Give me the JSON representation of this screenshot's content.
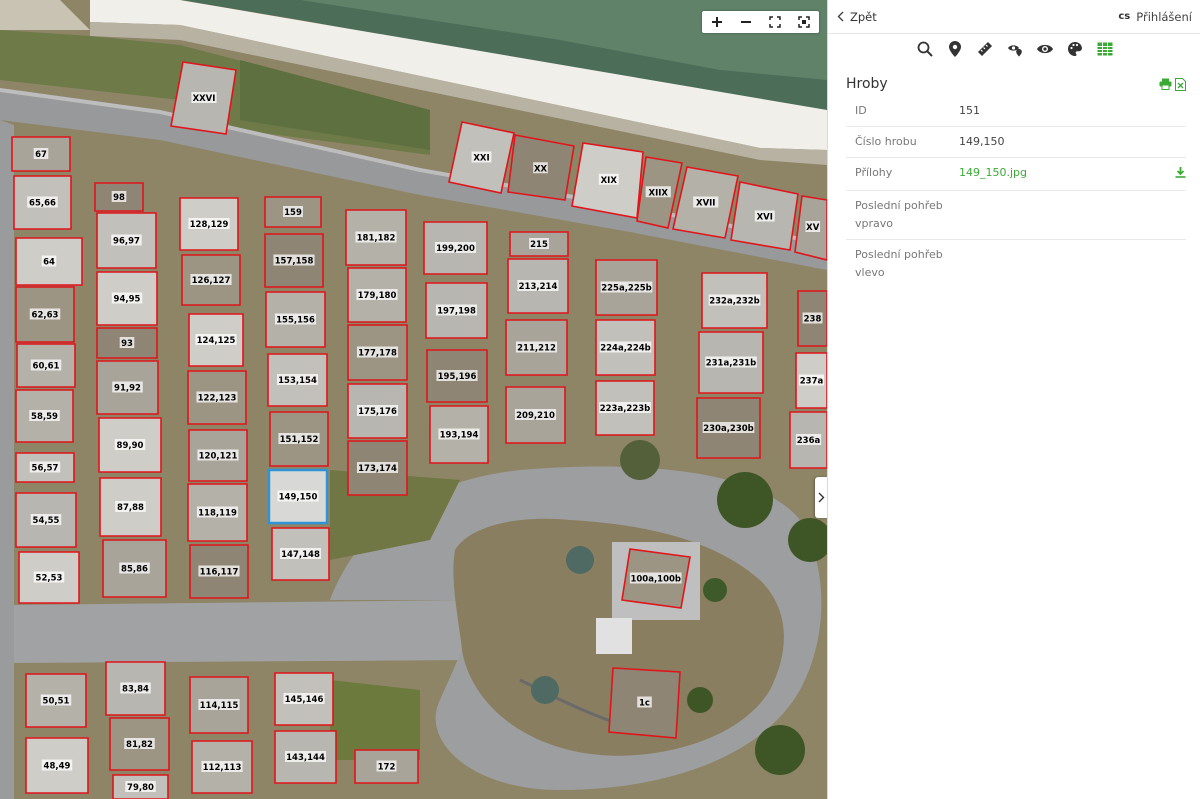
{
  "panel": {
    "back_label": "Zpět",
    "lang": "cs",
    "login_label": "Přihlášení",
    "toolbar": [
      {
        "name": "search-icon"
      },
      {
        "name": "location-pin-icon"
      },
      {
        "name": "measure-icon"
      },
      {
        "name": "location-eye-icon"
      },
      {
        "name": "eye-icon"
      },
      {
        "name": "palette-icon"
      },
      {
        "name": "table-icon"
      }
    ],
    "section_title": "Hroby",
    "rows": [
      {
        "key": "ID",
        "value": "151"
      },
      {
        "key": "Číslo hrobu",
        "value": "149,150"
      },
      {
        "key": "Přílohy",
        "value": "149_150.jpg"
      },
      {
        "key": "Poslední pohřeb vpravo",
        "value": ""
      },
      {
        "key": "Poslední pohřeb vlevo",
        "value": ""
      }
    ]
  },
  "colors": {
    "accent_green": "#3aaa35",
    "plot_outline": "#e0141b",
    "selected_outline": "#2f93d6"
  },
  "map": {
    "plots": [
      {
        "label": "XXVI"
      },
      {
        "label": "67"
      },
      {
        "label": "XXI"
      },
      {
        "label": "XX"
      },
      {
        "label": "XIX"
      },
      {
        "label": "XIIX"
      },
      {
        "label": "XVII"
      },
      {
        "label": "XVI"
      },
      {
        "label": "XV"
      },
      {
        "label": "65,66"
      },
      {
        "label": "98"
      },
      {
        "label": "128,129"
      },
      {
        "label": "159"
      },
      {
        "label": "181,182"
      },
      {
        "label": "199,200"
      },
      {
        "label": "215"
      },
      {
        "label": "96,97"
      },
      {
        "label": "157,158"
      },
      {
        "label": "64"
      },
      {
        "label": "126,127"
      },
      {
        "label": "179,180"
      },
      {
        "label": "213,214"
      },
      {
        "label": "225a,225b"
      },
      {
        "label": "232a,232b"
      },
      {
        "label": "238"
      },
      {
        "label": "94,95"
      },
      {
        "label": "62,63"
      },
      {
        "label": "155,156"
      },
      {
        "label": "197,198"
      },
      {
        "label": "211,212"
      },
      {
        "label": "224a,224b"
      },
      {
        "label": "93"
      },
      {
        "label": "124,125"
      },
      {
        "label": "177,178"
      },
      {
        "label": "60,61"
      },
      {
        "label": "231a,231b"
      },
      {
        "label": "91,92"
      },
      {
        "label": "153,154"
      },
      {
        "label": "195,196"
      },
      {
        "label": "237a"
      },
      {
        "label": "122,123"
      },
      {
        "label": "58,59"
      },
      {
        "label": "175,176"
      },
      {
        "label": "209,210"
      },
      {
        "label": "223a,223b"
      },
      {
        "label": "230a,230b"
      },
      {
        "label": "89,90"
      },
      {
        "label": "151,152"
      },
      {
        "label": "193,194"
      },
      {
        "label": "236a"
      },
      {
        "label": "120,121"
      },
      {
        "label": "56,57"
      },
      {
        "label": "173,174"
      },
      {
        "label": "87,88"
      },
      {
        "label": "149,150",
        "selected": true
      },
      {
        "label": "118,119"
      },
      {
        "label": "54,55"
      },
      {
        "label": "85,86"
      },
      {
        "label": "147,148"
      },
      {
        "label": "116,117"
      },
      {
        "label": "52,53"
      },
      {
        "label": "100a,100b"
      },
      {
        "label": "50,51"
      },
      {
        "label": "83,84"
      },
      {
        "label": "114,115"
      },
      {
        "label": "145,146"
      },
      {
        "label": "1c"
      },
      {
        "label": "48,49"
      },
      {
        "label": "81,82"
      },
      {
        "label": "112,113"
      },
      {
        "label": "143,144"
      },
      {
        "label": "172"
      },
      {
        "label": "79,80"
      }
    ]
  }
}
